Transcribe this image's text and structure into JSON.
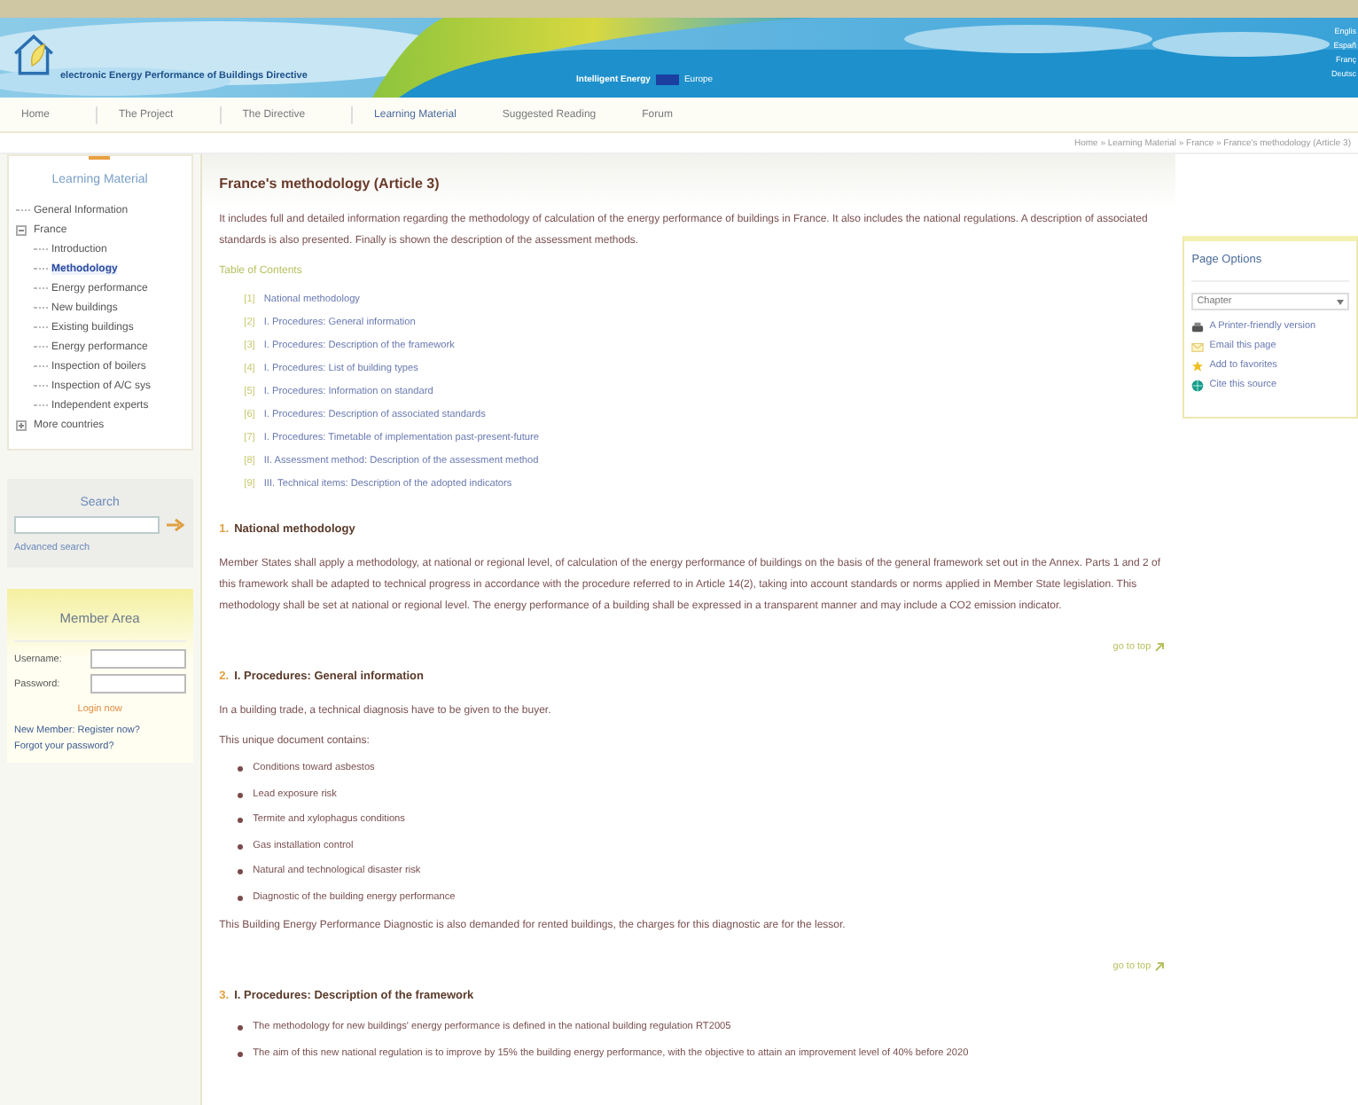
{
  "header": {
    "site_title": "electronic Energy Performance of Buildings Directive",
    "partner": "Intelligent Energy",
    "partner_suffix": "Europe",
    "languages": [
      "Englis",
      "Españ",
      "Franç",
      "Deutsc"
    ]
  },
  "nav": [
    {
      "label": "Home",
      "selected": false
    },
    {
      "label": "The Project",
      "selected": false
    },
    {
      "label": "The Directive",
      "selected": false
    },
    {
      "label": "Learning Material",
      "selected": true
    },
    {
      "label": "Suggested Reading",
      "selected": false
    },
    {
      "label": "Forum",
      "selected": false
    }
  ],
  "breadcrumb": "Home » Learning Material » France » France's methodology (Article 3)",
  "sidebar": {
    "title": "Learning Material",
    "tree": [
      {
        "label": "General Information",
        "selected": false
      },
      {
        "label": "France",
        "selected": false,
        "expanded": true,
        "children": [
          {
            "label": "Introduction",
            "selected": false
          },
          {
            "label": "Methodology",
            "selected": true
          },
          {
            "label": "Energy performance",
            "selected": false
          },
          {
            "label": "New buildings",
            "selected": false
          },
          {
            "label": "Existing buildings",
            "selected": false
          },
          {
            "label": "Energy performance",
            "selected": false
          },
          {
            "label": "Inspection of boilers",
            "selected": false
          },
          {
            "label": "Inspection of A/C sys",
            "selected": false
          },
          {
            "label": "Independent experts",
            "selected": false
          }
        ]
      },
      {
        "label": "More countries",
        "selected": false,
        "expanded": false
      }
    ],
    "search": {
      "title": "Search",
      "link": "Advanced search"
    },
    "member": {
      "title": "Member Area",
      "username_label": "Username:",
      "password_label": "Password:",
      "login": "Login now",
      "register": "New Member: Register now?",
      "forgot": "Forgot your password?"
    }
  },
  "main": {
    "title": "France's methodology (Article 3)",
    "intro": "It includes full and detailed information regarding the methodology of calculation of the energy performance of buildings in France. It also includes the national regulations. A description of associated standards is also presented. Finally is shown the description of the assessment methods.",
    "toc_title": "Table of Contents",
    "toc": [
      {
        "num": "[1]",
        "label": "National methodology"
      },
      {
        "num": "[2]",
        "label": "I. Procedures: General information"
      },
      {
        "num": "[3]",
        "label": "I. Procedures: Description of the framework"
      },
      {
        "num": "[4]",
        "label": "I. Procedures: List of building types"
      },
      {
        "num": "[5]",
        "label": "I. Procedures: Information on standard"
      },
      {
        "num": "[6]",
        "label": "I. Procedures: Description of associated standards"
      },
      {
        "num": "[7]",
        "label": "I. Procedures: Timetable of implementation past-present-future"
      },
      {
        "num": "[8]",
        "label": "II. Assessment method: Description of the assessment method"
      },
      {
        "num": "[9]",
        "label": "III. Technical items: Description of the adopted indicators"
      }
    ],
    "sections": [
      {
        "num": "1.",
        "title": "National methodology",
        "blocks": [
          {
            "kind": "paragraph",
            "text": "Member States shall apply a methodology, at national or regional level, of calculation of the energy performance of buildings on the basis of the general framework set out in the Annex. Parts 1 and 2 of this framework shall be adapted to technical progress in accordance with the procedure referred to in Article 14(2), taking into account standards or norms applied in Member State legislation. This methodology shall be set at national or regional level. The energy performance of a building shall be expressed in a transparent manner and may include a CO2 emission indicator."
          }
        ],
        "top_link": "go to top"
      },
      {
        "num": "2.",
        "title": "I. Procedures: General information",
        "blocks": [
          {
            "kind": "paragraph",
            "text": "In a building trade, a technical diagnosis have to be given to the buyer."
          },
          {
            "kind": "paragraph",
            "text": "This unique document contains:"
          },
          {
            "kind": "list",
            "items": [
              "Conditions toward asbestos",
              "Lead exposure risk",
              "Termite and xylophagus conditions",
              "Gas installation control",
              "Natural and technological disaster risk",
              "Diagnostic of the building energy performance"
            ]
          },
          {
            "kind": "paragraph",
            "text": "This Building Energy Performance Diagnostic is also demanded for rented buildings, the charges for this diagnostic are for the lessor."
          }
        ],
        "top_link": "go to top"
      },
      {
        "num": "3.",
        "title": "I. Procedures: Description of the framework",
        "blocks": [
          {
            "kind": "list",
            "items": [
              "The methodology for new buildings' energy performance is defined in the national building regulation RT2005",
              "The aim of this new national regulation is to improve by 15% the building energy performance, with the objective to attain an improvement level of 40% before 2020"
            ]
          }
        ]
      }
    ]
  },
  "options": {
    "title": "Page Options",
    "select": "Chapter",
    "items": [
      {
        "kind": "print",
        "label": "A Printer-friendly version"
      },
      {
        "kind": "email",
        "label": "Email this page"
      },
      {
        "kind": "favorite",
        "label": "Add to favorites"
      },
      {
        "kind": "cite",
        "label": "Cite this source"
      }
    ]
  }
}
